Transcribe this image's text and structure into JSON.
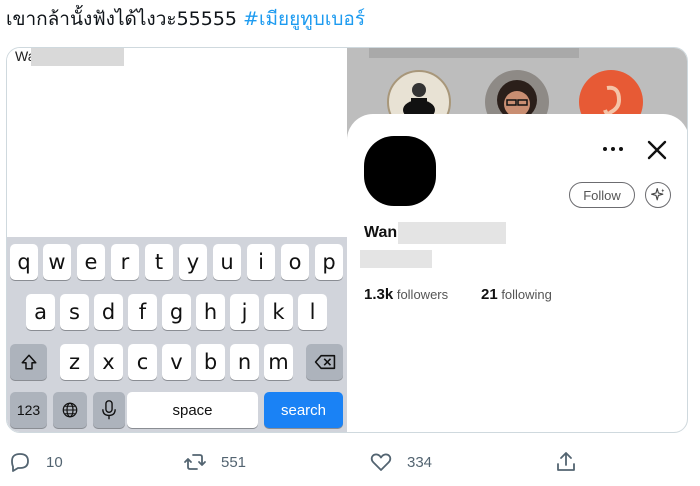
{
  "tweet": {
    "text": "เขากล้านั้งฟังได้ไงวะ55555",
    "hashtag": "#เมียยูทูบเบอร์"
  },
  "left_panel": {
    "search_text": "Wa",
    "keyboard": {
      "row1": [
        "q",
        "w",
        "e",
        "r",
        "t",
        "y",
        "u",
        "i",
        "o",
        "p"
      ],
      "row2": [
        "a",
        "s",
        "d",
        "f",
        "g",
        "h",
        "j",
        "k",
        "l"
      ],
      "row3": [
        "z",
        "x",
        "c",
        "v",
        "b",
        "n",
        "m"
      ],
      "numbers_key": "123",
      "space_key": "space",
      "search_key": "search"
    }
  },
  "profile_card": {
    "name": "Wan",
    "follow_label": "Follow",
    "followers_count": "1.3k",
    "followers_label": "followers",
    "following_count": "21",
    "following_label": "following"
  },
  "actions": {
    "replies": "10",
    "retweets": "551",
    "likes": "334"
  },
  "colors": {
    "hashtag": "#1d9bf0",
    "search_key": "#1a82f5",
    "keyboard_bg": "#d1d4db",
    "action_gray": "#536471"
  },
  "icons": [
    "reply-icon",
    "retweet-icon",
    "like-icon",
    "share-icon",
    "more-icon",
    "close-icon",
    "sparkle-icon",
    "shift-icon",
    "backspace-icon",
    "globe-icon",
    "microphone-icon"
  ]
}
